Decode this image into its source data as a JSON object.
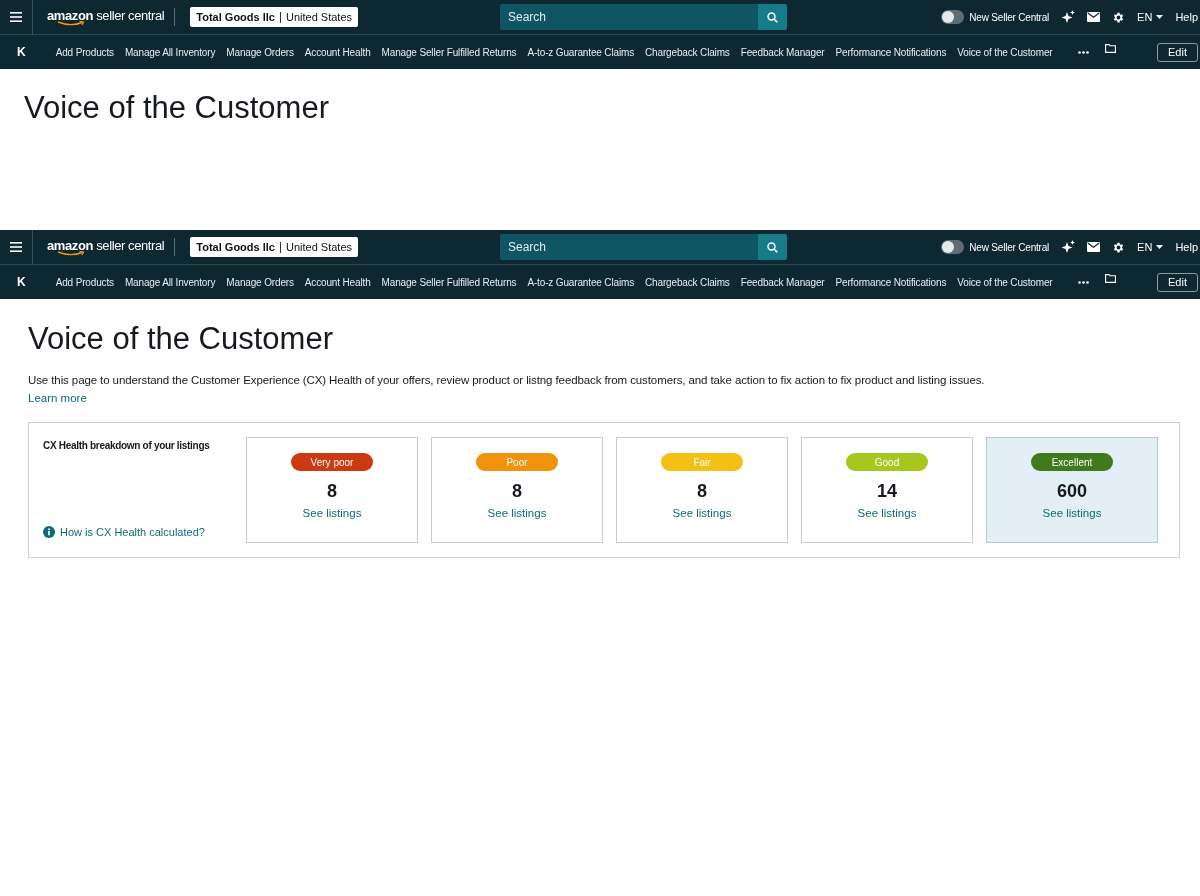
{
  "screens": [
    {
      "top_bar": {
        "logo": "**amazon** seller central",
        "account": {
          "store": "Total Goods llc",
          "region": "United States"
        },
        "search": {
          "placeholder": "Search"
        },
        "toggle": {
          "label": "New Seller Central",
          "on": false
        },
        "language": "EN",
        "help": "Help"
      },
      "nav_bar": {
        "home": "K",
        "items": [
          "Add Products",
          "Manage All Inventory",
          "Manage Orders",
          "Account Health",
          "Manage Seller Fulfilled Returns",
          "A-to-z Guarantee Claims",
          "Chargeback Claims",
          "Feedback Manager",
          "Performance Notifications",
          "Voice of the Customer"
        ],
        "edit": "Edit"
      },
      "page": {
        "title": "Voice of the Customer"
      }
    },
    {
      "top_bar": {
        "logo": "**amazon** seller central",
        "account": {
          "store": "Total Goods llc",
          "region": "United States"
        },
        "search": {
          "placeholder": "Search"
        },
        "toggle": {
          "label": "New Seller Central",
          "on": false
        },
        "language": "EN",
        "help": "Help"
      },
      "nav_bar": {
        "home": "K",
        "items": [
          "Add Products",
          "Manage All Inventory",
          "Manage Orders",
          "Account Health",
          "Manage Seller Fulfilled Returns",
          "A-to-z Guarantee Claims",
          "Chargeback Claims",
          "Feedback Manager",
          "Performance Notifications",
          "Voice of the Customer"
        ],
        "edit": "Edit"
      },
      "page": {
        "title": "Voice of the Customer",
        "description": "Use this page to understand the Customer Experience (CX) Health of your offers, review product or listng feedback from customers, and take action to fix action to fix product and listing issues.",
        "learn_more": "Learn more",
        "cx_health": {
          "heading": "CX Health breakdown of your listings",
          "help_link": "How is CX Health calculated?",
          "cards": [
            {
              "label": "Very poor",
              "color": "#cc3a12",
              "count": "8",
              "link": "See listings",
              "selected": false
            },
            {
              "label": "Poor",
              "color": "#f0920c",
              "count": "8",
              "link": "See listings",
              "selected": false
            },
            {
              "label": "Fair",
              "color": "#f3c013",
              "count": "8",
              "link": "See listings",
              "selected": false
            },
            {
              "label": "Good",
              "color": "#a7c71f",
              "count": "14",
              "link": "See listings",
              "selected": false
            },
            {
              "label": "Excellent",
              "color": "#3f7a1c",
              "count": "600",
              "link": "See listings",
              "selected": true
            }
          ]
        }
      }
    }
  ]
}
